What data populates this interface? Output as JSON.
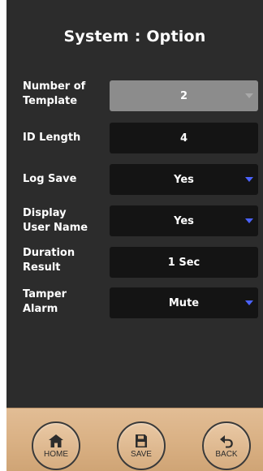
{
  "screen": {
    "title": "System : Option"
  },
  "options": [
    {
      "label": "Number of\nTemplate",
      "value": "2",
      "type": "select",
      "disabled": true
    },
    {
      "label": "ID Length",
      "value": "4",
      "type": "text",
      "disabled": false
    },
    {
      "label": "Log Save",
      "value": "Yes",
      "type": "select",
      "disabled": false
    },
    {
      "label": "Display\nUser Name",
      "value": "Yes",
      "type": "select",
      "disabled": false
    },
    {
      "label": "Duration\nResult",
      "value": "1 Sec",
      "type": "text",
      "disabled": false
    },
    {
      "label": "Tamper\nAlarm",
      "value": "Mute",
      "type": "select",
      "disabled": false
    }
  ],
  "nav": {
    "home": {
      "label": "HOME",
      "icon": "home-icon"
    },
    "save": {
      "label": "SAVE",
      "icon": "save-icon"
    },
    "back": {
      "label": "BACK",
      "icon": "back-arrow-icon"
    }
  },
  "colors": {
    "background": "#2c2c2c",
    "field": "#141414",
    "field_disabled": "#8c8c8c",
    "dropdown_arrow": "#4b63ff",
    "bottom_bar": "#d9b083"
  }
}
